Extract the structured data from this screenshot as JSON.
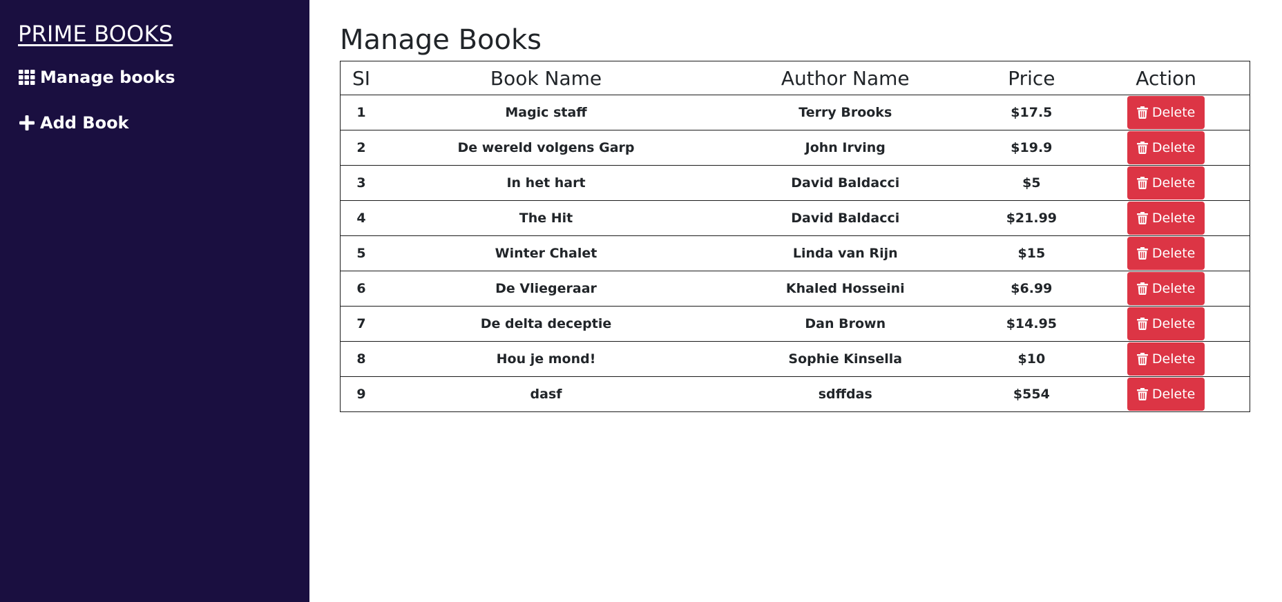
{
  "sidebar": {
    "brand": "PRIME BOOKS",
    "items": [
      {
        "label": "Manage books",
        "icon": "grid-icon"
      },
      {
        "label": "Add Book",
        "icon": "plus-icon"
      }
    ]
  },
  "main": {
    "title": "Manage Books",
    "columns": [
      "SI",
      "Book Name",
      "Author Name",
      "Price",
      "Action"
    ],
    "delete_label": "Delete",
    "rows": [
      {
        "si": "1",
        "book": "Magic staff",
        "author": "Terry Brooks",
        "price": "$17.5"
      },
      {
        "si": "2",
        "book": "De wereld volgens Garp",
        "author": "John Irving",
        "price": "$19.9"
      },
      {
        "si": "3",
        "book": "In het hart",
        "author": "David Baldacci",
        "price": "$5"
      },
      {
        "si": "4",
        "book": "The Hit",
        "author": "David Baldacci",
        "price": "$21.99"
      },
      {
        "si": "5",
        "book": "Winter Chalet",
        "author": "Linda van Rijn",
        "price": "$15"
      },
      {
        "si": "6",
        "book": "De Vliegeraar",
        "author": "Khaled Hosseini",
        "price": "$6.99"
      },
      {
        "si": "7",
        "book": "De delta deceptie",
        "author": "Dan Brown",
        "price": "$14.95"
      },
      {
        "si": "8",
        "book": "Hou je mond!",
        "author": "Sophie Kinsella",
        "price": "$10"
      },
      {
        "si": "9",
        "book": "dasf",
        "author": "sdffdas",
        "price": "$554"
      }
    ]
  },
  "colors": {
    "sidebar_bg": "#1a0f40",
    "delete_bg": "#dc3545"
  }
}
